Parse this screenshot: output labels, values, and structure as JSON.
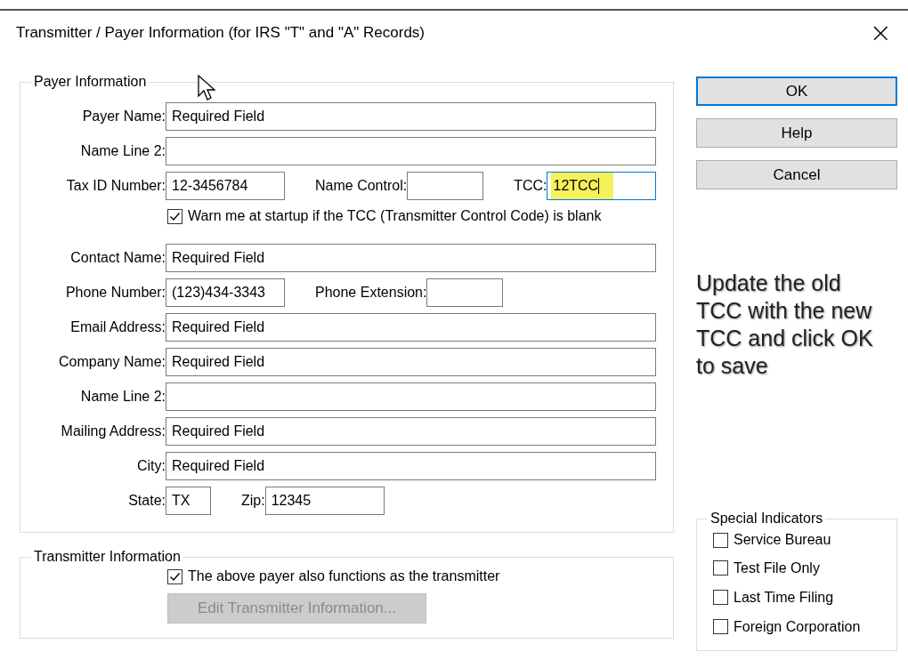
{
  "window": {
    "title": "Transmitter / Payer Information (for IRS \"T\" and \"A\" Records)",
    "close": "×"
  },
  "payer": {
    "legend": "Payer Information",
    "rows": [
      {
        "kind": "fields",
        "fields": [
          {
            "label": "Payer Name:",
            "value": "Required Field",
            "kind": "wide",
            "focused": false,
            "highlighted": false
          }
        ]
      },
      {
        "kind": "fields",
        "fields": [
          {
            "label": "Name Line 2:",
            "kind": "wide",
            "focused": false,
            "highlighted": false
          }
        ]
      },
      {
        "kind": "fields",
        "fields": [
          {
            "label": "Tax ID Number:",
            "value": "12-3456784",
            "kind": "medium",
            "focused": false,
            "highlighted": false
          },
          {
            "label": "Name Control:",
            "kind": "small",
            "focused": false,
            "highlighted": false
          },
          {
            "label": "TCC:",
            "value": "12TCC",
            "kind": "wide",
            "focused": true,
            "highlighted": true
          }
        ]
      },
      {
        "kind": "checkbox",
        "label": "Warn me at startup if the TCC (Transmitter Control Code) is blank",
        "checked": true
      },
      {
        "kind": "fields",
        "fields": [
          {
            "label": "Contact Name:",
            "value": "Required Field",
            "kind": "wide",
            "focused": false,
            "highlighted": false
          }
        ]
      },
      {
        "kind": "fields",
        "fields": [
          {
            "label": "Phone Number:",
            "value": "(123)434-3343",
            "kind": "medium",
            "focused": false,
            "highlighted": false
          },
          {
            "label": "Phone Extension:",
            "kind": "small",
            "focused": false,
            "highlighted": false
          }
        ]
      },
      {
        "kind": "fields",
        "fields": [
          {
            "label": "Email Address:",
            "value": "Required Field",
            "kind": "wide",
            "focused": false,
            "highlighted": false
          }
        ]
      },
      {
        "kind": "fields",
        "fields": [
          {
            "label": "Company Name:",
            "value": "Required Field",
            "kind": "wide",
            "focused": false,
            "highlighted": false
          }
        ]
      },
      {
        "kind": "fields",
        "fields": [
          {
            "label": "Name Line 2:",
            "kind": "wide",
            "focused": false,
            "highlighted": false
          }
        ]
      },
      {
        "kind": "fields",
        "fields": [
          {
            "label": "Mailing Address:",
            "value": "Required Field",
            "kind": "wide",
            "focused": false,
            "highlighted": false
          }
        ]
      },
      {
        "kind": "fields",
        "fields": [
          {
            "label": "City:",
            "value": "Required Field",
            "kind": "wide",
            "focused": false,
            "highlighted": false
          }
        ]
      },
      {
        "kind": "fields",
        "fields": [
          {
            "label": "State:",
            "value": "TX",
            "kind": "tiny",
            "focused": false,
            "highlighted": false
          },
          {
            "label": "Zip:",
            "value": "12345",
            "kind": "medium",
            "focused": false,
            "highlighted": false
          }
        ]
      }
    ]
  },
  "transmitter": {
    "legend": "Transmitter Information",
    "checkbox": {
      "label": "The above payer also functions as the transmitter",
      "checked": true
    },
    "button": {
      "label": "Edit Transmitter Information...",
      "disabled": true
    }
  },
  "buttons": [
    {
      "label": "OK",
      "default": true
    },
    {
      "label": "Help",
      "default": false
    },
    {
      "label": "Cancel",
      "default": false
    }
  ],
  "annotation": "Update the old TCC with the new TCC and click OK to save",
  "special_indicators": {
    "legend": "Special Indicators",
    "items": [
      {
        "label": "Service Bureau",
        "checked": false
      },
      {
        "label": "Test File Only",
        "checked": false
      },
      {
        "label": "Last Time Filing",
        "checked": false
      },
      {
        "label": "Foreign Corporation",
        "checked": false
      }
    ]
  }
}
